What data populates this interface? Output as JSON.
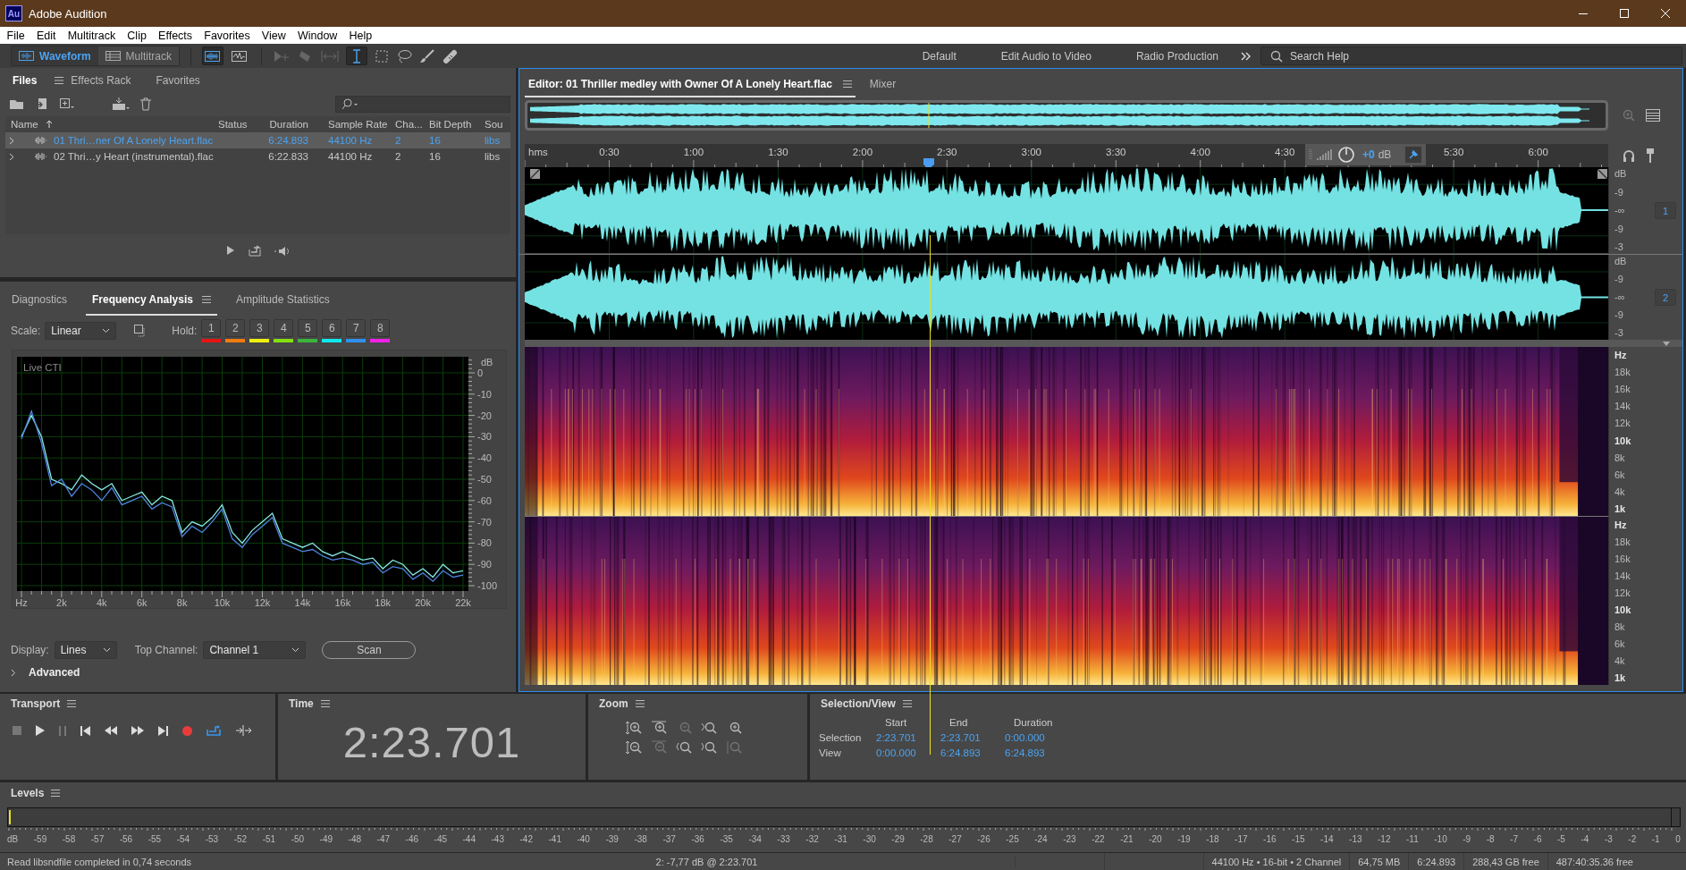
{
  "window": {
    "title": "Adobe Audition",
    "app_badge": "Au"
  },
  "menu": [
    "File",
    "Edit",
    "Multitrack",
    "Clip",
    "Effects",
    "Favorites",
    "View",
    "Window",
    "Help"
  ],
  "modes": [
    {
      "label": "Waveform",
      "selected": true
    },
    {
      "label": "Multitrack",
      "selected": false
    }
  ],
  "workspaces": [
    "Default",
    "Edit Audio to Video",
    "Radio Production"
  ],
  "search": {
    "placeholder": "Search Help"
  },
  "files_panel": {
    "tabs": [
      {
        "label": "Files",
        "selected": true
      },
      {
        "label": "Effects Rack",
        "selected": false
      },
      {
        "label": "Favorites",
        "selected": false
      }
    ],
    "table": {
      "columns": [
        "Name",
        "Status",
        "Duration",
        "Sample Rate",
        "Cha...",
        "Bit Depth",
        "Sou"
      ],
      "rows": [
        {
          "selected": true,
          "cells": [
            "01 Thri…ner Of A Lonely Heart.flac",
            "",
            "6:24.893",
            "44100 Hz",
            "2",
            "16",
            "libs"
          ]
        },
        {
          "selected": false,
          "cells": [
            "02 Thri…y Heart (instrumental).flac",
            "",
            "6:22.833",
            "44100 Hz",
            "2",
            "16",
            "libs"
          ]
        }
      ]
    }
  },
  "frequency_panel": {
    "tabs": [
      {
        "label": "Diagnostics",
        "selected": false
      },
      {
        "label": "Frequency Analysis",
        "selected": true
      },
      {
        "label": "Amplitude Statistics",
        "selected": false
      }
    ],
    "scale_label": "Scale:",
    "scale": "Linear",
    "hold_label": "Hold:",
    "holds": [
      {
        "label": "1",
        "color": "#e81414"
      },
      {
        "label": "2",
        "color": "#f07c10"
      },
      {
        "label": "3",
        "color": "#f0f010"
      },
      {
        "label": "4",
        "color": "#84e010"
      },
      {
        "label": "5",
        "color": "#3cb43c"
      },
      {
        "label": "6",
        "color": "#10e8f0"
      },
      {
        "label": "7",
        "color": "#3090f0"
      },
      {
        "label": "8",
        "color": "#f020e8"
      }
    ],
    "chart_data": {
      "type": "line",
      "grid": true,
      "title": "Live CTI",
      "ylabel": "dB",
      "xlim": [
        0,
        22000
      ],
      "ylim": [
        -100,
        0
      ],
      "x": [
        0,
        500,
        1000,
        1500,
        2000,
        2500,
        3000,
        3500,
        4000,
        4500,
        5000,
        5500,
        6000,
        6500,
        7000,
        7500,
        8000,
        8500,
        9000,
        9500,
        10000,
        10500,
        11000,
        11500,
        12000,
        12500,
        13000,
        13500,
        14000,
        14500,
        15000,
        15500,
        16000,
        16500,
        17000,
        17500,
        18000,
        18500,
        19000,
        19500,
        20000,
        20500,
        21000,
        21500,
        22000
      ],
      "series": [
        {
          "color": "#86e8e0",
          "values": [
            -30,
            -20,
            -30,
            -50,
            -52,
            -55,
            -48,
            -52,
            -55,
            -52,
            -60,
            -58,
            -56,
            -62,
            -58,
            -60,
            -75,
            -70,
            -72,
            -68,
            -62,
            -75,
            -80,
            -74,
            -70,
            -66,
            -78,
            -80,
            -82,
            -80,
            -84,
            -86,
            -84,
            -86,
            -88,
            -87,
            -92,
            -88,
            -90,
            -95,
            -92,
            -96,
            -90,
            -94,
            -93
          ]
        },
        {
          "color": "#4f84e0",
          "values": [
            -31,
            -18,
            -33,
            -53,
            -50,
            -58,
            -52,
            -55,
            -60,
            -54,
            -62,
            -60,
            -58,
            -64,
            -61,
            -63,
            -77,
            -72,
            -75,
            -70,
            -64,
            -78,
            -82,
            -76,
            -72,
            -68,
            -80,
            -82,
            -84,
            -83,
            -86,
            -88,
            -87,
            -88,
            -90,
            -89,
            -94,
            -91,
            -92,
            -97,
            -94,
            -98,
            -93,
            -96,
            -95
          ]
        }
      ],
      "xticks": [
        {
          "value": 0,
          "label": "Hz"
        },
        {
          "value": 2000,
          "label": "2k"
        },
        {
          "value": 4000,
          "label": "4k"
        },
        {
          "value": 6000,
          "label": "6k"
        },
        {
          "value": 8000,
          "label": "8k"
        },
        {
          "value": 10000,
          "label": "10k"
        },
        {
          "value": 12000,
          "label": "12k"
        },
        {
          "value": 14000,
          "label": "14k"
        },
        {
          "value": 16000,
          "label": "16k"
        },
        {
          "value": 18000,
          "label": "18k"
        },
        {
          "value": 20000,
          "label": "20k"
        },
        {
          "value": 22000,
          "label": "22k"
        }
      ],
      "yticks": [
        0,
        -10,
        -20,
        -30,
        -40,
        -50,
        -60,
        -70,
        -80,
        -90,
        -100
      ]
    },
    "display_label": "Display:",
    "display": "Lines",
    "top_channel_label": "Top Channel:",
    "top_channel": "Channel 1",
    "scan_button": "Scan",
    "advanced": {
      "label": "Advanced",
      "expanded": false
    }
  },
  "editor": {
    "tabs": [
      {
        "label": "Editor: 01 Thriller medley with Owner Of A Lonely Heart.flac",
        "selected": true
      },
      {
        "label": "Mixer",
        "selected": false
      }
    ],
    "ruler": {
      "unit": "hms",
      "labels": [
        "0:30",
        "1:00",
        "1:30",
        "2:00",
        "2:30",
        "3:00",
        "3:30",
        "4:00",
        "4:30",
        "5:30",
        "6:00"
      ]
    },
    "hud": {
      "gain": "+0",
      "unit": "dB"
    },
    "channels": [
      {
        "badge": "1",
        "scale": [
          "dB",
          "-9",
          "-∞",
          "-9",
          "-3"
        ]
      },
      {
        "badge": "2",
        "scale": [
          "dB",
          "-9",
          "-∞",
          "-9",
          "-3"
        ]
      }
    ],
    "spectral_channels": [
      {
        "scale": [
          {
            "label": "Hz",
            "major": true
          },
          {
            "label": "18k",
            "major": false
          },
          {
            "label": "16k",
            "major": false
          },
          {
            "label": "14k",
            "major": false
          },
          {
            "label": "12k",
            "major": false
          },
          {
            "label": "10k",
            "major": true
          },
          {
            "label": "8k",
            "major": false
          },
          {
            "label": "6k",
            "major": false
          },
          {
            "label": "4k",
            "major": false
          },
          {
            "label": "1k",
            "major": true
          }
        ]
      },
      {
        "scale": [
          {
            "label": "Hz",
            "major": true
          },
          {
            "label": "18k",
            "major": false
          },
          {
            "label": "16k",
            "major": false
          },
          {
            "label": "14k",
            "major": false
          },
          {
            "label": "12k",
            "major": false
          },
          {
            "label": "10k",
            "major": true
          },
          {
            "label": "8k",
            "major": false
          },
          {
            "label": "6k",
            "major": false
          },
          {
            "label": "4k",
            "major": false
          },
          {
            "label": "1k",
            "major": true
          }
        ]
      }
    ]
  },
  "transport": {
    "title": "Transport"
  },
  "time": {
    "title": "Time",
    "value": "2:23.701"
  },
  "zoom": {
    "title": "Zoom"
  },
  "selection_view": {
    "title": "Selection/View",
    "columns": [
      "Start",
      "End",
      "Duration"
    ],
    "rows": [
      {
        "label": "Selection",
        "values": [
          "2:23.701",
          "2:23.701",
          "0:00.000"
        ]
      },
      {
        "label": "View",
        "values": [
          "0:00.000",
          "6:24.893",
          "6:24.893"
        ]
      }
    ]
  },
  "levels": {
    "title": "Levels",
    "scale": [
      "dB",
      "-59",
      "-58",
      "-57",
      "-56",
      "-55",
      "-54",
      "-53",
      "-52",
      "-51",
      "-50",
      "-49",
      "-48",
      "-47",
      "-46",
      "-45",
      "-44",
      "-43",
      "-42",
      "-41",
      "-40",
      "-39",
      "-38",
      "-37",
      "-36",
      "-35",
      "-34",
      "-33",
      "-32",
      "-31",
      "-30",
      "-29",
      "-28",
      "-27",
      "-26",
      "-25",
      "-24",
      "-23",
      "-22",
      "-21",
      "-20",
      "-19",
      "-18",
      "-17",
      "-16",
      "-15",
      "-14",
      "-13",
      "-12",
      "-11",
      "-10",
      "-9",
      "-8",
      "-7",
      "-6",
      "-5",
      "-4",
      "-3",
      "-2",
      "-1",
      "0"
    ]
  },
  "status_bar": {
    "message": "Read libsndfile completed in 0,74 seconds",
    "cursor": "2: -7,77 dB @ 2:23.701",
    "items": [
      "44100 Hz • 16-bit • 2 Channel",
      "64,75 MB",
      "6:24.893",
      "288,43 GB free",
      "487:40:35.36 free"
    ]
  }
}
